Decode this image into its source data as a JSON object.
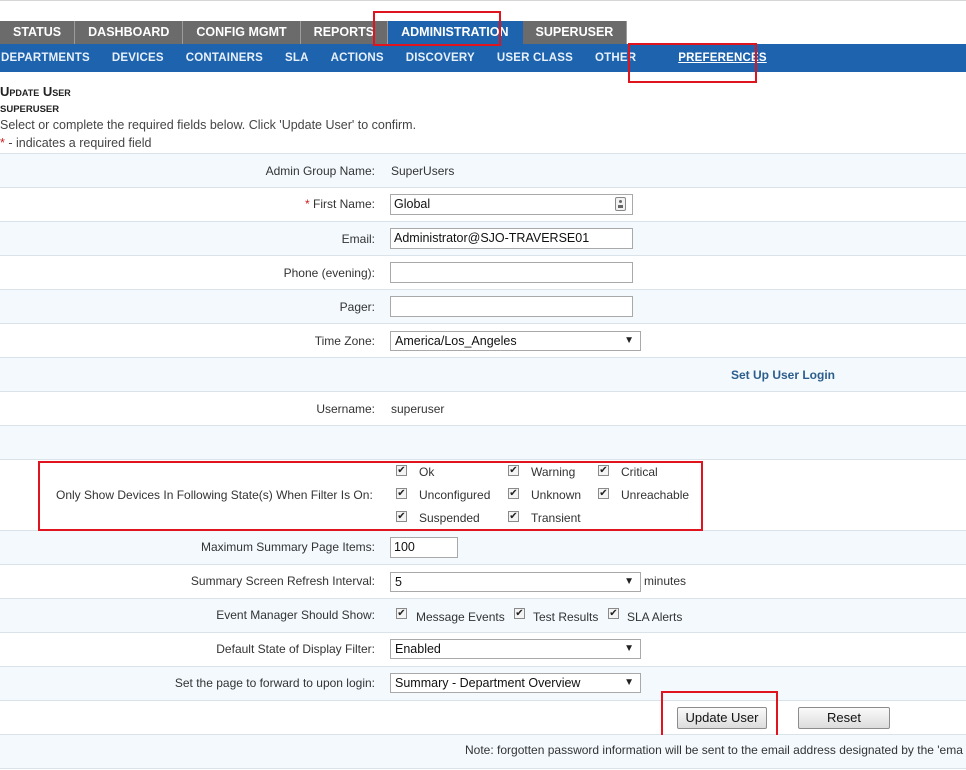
{
  "nav": {
    "top_tabs": [
      "STATUS",
      "DASHBOARD",
      "CONFIG MGMT",
      "REPORTS",
      "ADMINISTRATION",
      "SUPERUSER"
    ],
    "active_top_tab": "ADMINISTRATION",
    "sub_tabs": [
      "DEPARTMENTS",
      "DEVICES",
      "CONTAINERS",
      "SLA",
      "ACTIONS",
      "DISCOVERY",
      "USER CLASS",
      "OTHER",
      "PREFERENCES"
    ],
    "active_sub_tab": "PREFERENCES"
  },
  "page": {
    "title": "Update User",
    "subtitle": "SUPERUSER",
    "instructions": "Select or complete the required fields below. Click 'Update User' to confirm.",
    "required_star": "*",
    "required_note": " - indicates a required field"
  },
  "form": {
    "admin_group": {
      "label": "Admin Group Name:",
      "value": "SuperUsers"
    },
    "first_name": {
      "label": "First Name:",
      "value": "Global"
    },
    "email": {
      "label": "Email:",
      "value": "Administrator@SJO-TRAVERSE01"
    },
    "phone": {
      "label": "Phone (evening):",
      "value": ""
    },
    "pager": {
      "label": "Pager:",
      "value": ""
    },
    "timezone": {
      "label": "Time Zone:",
      "value": "America/Los_Angeles"
    },
    "setup_login_link": "Set Up User Login",
    "username": {
      "label": "Username:",
      "value": "superuser"
    },
    "state_filter": {
      "label": "Only Show Devices In Following State(s) When Filter Is On:",
      "states": [
        {
          "name": "Ok",
          "checked": true
        },
        {
          "name": "Warning",
          "checked": true
        },
        {
          "name": "Critical",
          "checked": true
        },
        {
          "name": "Unconfigured",
          "checked": true
        },
        {
          "name": "Unknown",
          "checked": true
        },
        {
          "name": "Unreachable",
          "checked": true
        },
        {
          "name": "Suspended",
          "checked": true
        },
        {
          "name": "Transient",
          "checked": true
        }
      ]
    },
    "max_summary": {
      "label": "Maximum Summary Page Items:",
      "value": "100"
    },
    "refresh": {
      "label": "Summary Screen Refresh Interval:",
      "value": "5",
      "unit": "minutes"
    },
    "event_manager": {
      "label": "Event Manager Should Show:",
      "options": [
        {
          "name": "Message Events",
          "checked": true
        },
        {
          "name": "Test Results",
          "checked": true
        },
        {
          "name": "SLA Alerts",
          "checked": true
        }
      ]
    },
    "display_filter": {
      "label": "Default State of Display Filter:",
      "value": "Enabled"
    },
    "forward_page": {
      "label": "Set the page to forward to upon login:",
      "value": "Summary - Department Overview"
    }
  },
  "buttons": {
    "update": "Update User",
    "reset": "Reset"
  },
  "footer_note": "Note: forgotten password information will be sent to the email address designated by the 'ema",
  "colors": {
    "accent": "#1d63ad",
    "highlight": "#e0141e",
    "tab_gray": "#6b6b6b",
    "row_alt": "#f3f9fd"
  }
}
